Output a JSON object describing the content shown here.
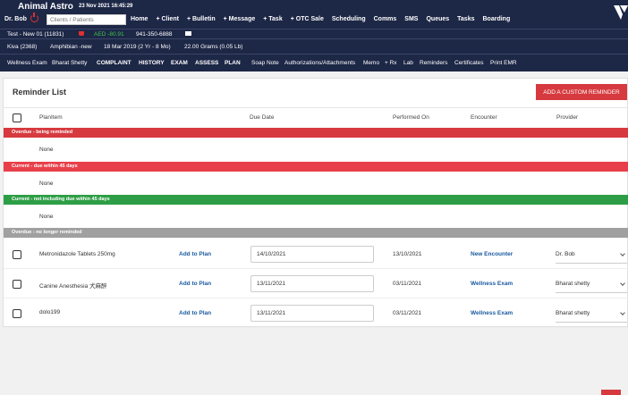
{
  "header": {
    "app_title": "Animal Astro",
    "datetime": "23 Nov 2021 16:45:29",
    "user": "Dr. Bob",
    "search_placeholder": "Clients / Patients",
    "nav": [
      "Home",
      "+ Client",
      "+ Bulletin",
      "+ Message",
      "+ Task",
      "+ OTC Sale",
      "Scheduling",
      "Comms",
      "SMS",
      "Queues",
      "Tasks",
      "Boarding"
    ]
  },
  "client_bar": {
    "client": "Test - New 01 (11831)",
    "balance": "AED -80.91",
    "phone": "941-350-6888"
  },
  "patient_bar": {
    "patient": "Kiva (2368)",
    "species": "Amphibian -new",
    "dob": "18 Mar 2019 (2 Yr - 8 Mo)",
    "weight": "22.00 Grams (0.05 Lb)"
  },
  "exam_bar": {
    "exam": "Wellness Exam",
    "doctor": "Bharat Shetty",
    "tabs": [
      "COMPLAINT",
      "HISTORY",
      "EXAM",
      "ASSESS",
      "PLAN"
    ],
    "tabs2": [
      "Soap Note",
      "Authorizations/Attachments",
      "Memo",
      "+ Rx",
      "Lab",
      "Reminders",
      "Certificates",
      "Print EMR"
    ]
  },
  "panel": {
    "title": "Reminder List",
    "add_button": "ADD A CUSTOM REMINDER",
    "columns": [
      "PlanItem",
      "Due Date",
      "Performed On",
      "Encounter",
      "Provider"
    ],
    "bands": [
      {
        "label": "Overdue - being reminded",
        "color": "#d63a3f",
        "empty": "None"
      },
      {
        "label": "Current - due within 45 days",
        "color": "#e8404a",
        "empty": "None"
      },
      {
        "label": "Current - not including due within 45 days",
        "color": "#2e9e46",
        "empty": "None"
      },
      {
        "label": "Overdue - no longer reminded",
        "color": "#a0a0a0"
      }
    ],
    "rows": [
      {
        "item": "Metronidazole Tablets 250mg",
        "action": "Add to Plan",
        "due": "14/10/2021",
        "performed": "13/10/2021",
        "encounter": "New Encounter",
        "provider": "Dr. Bob"
      },
      {
        "item": "Canine Anesthesia 犬麻醉",
        "action": "Add to Plan",
        "due": "13/11/2021",
        "performed": "03/11/2021",
        "encounter": "Wellness Exam",
        "provider": "Bharat shetty"
      },
      {
        "item": "dolo199",
        "action": "Add to Plan",
        "due": "13/11/2021",
        "performed": "03/11/2021",
        "encounter": "Wellness Exam",
        "provider": "Bharat shetty"
      }
    ]
  }
}
